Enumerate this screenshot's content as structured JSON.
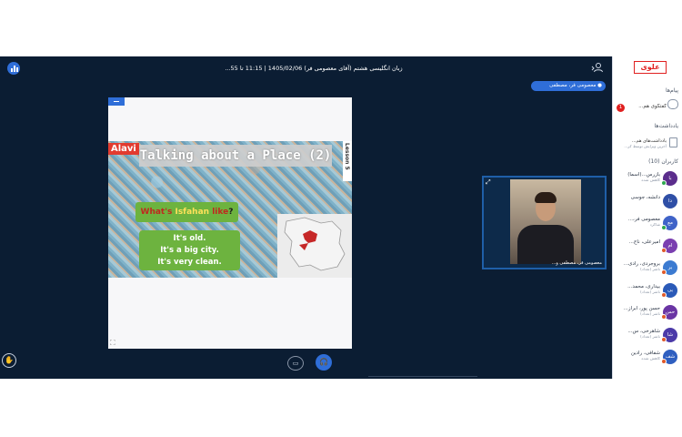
{
  "header": {
    "title": "زبان انگلیسی هشتم (آقای معصومی فر) 1405/02/06 | 11:15 تا 55...",
    "presenter_badge": "معصومی فر، مصطفی"
  },
  "slide": {
    "brand_tag": "Alavi",
    "title": "Talking about a Place (2)",
    "lesson_tag": "Lesson 5",
    "question": {
      "part1": "What's",
      "part2": " Isfahan ",
      "part3": "like",
      "part4": "?"
    },
    "answers": [
      "It's old.",
      "It's a big city.",
      "It's very clean."
    ]
  },
  "webcam": {
    "label": "معصومی فر، مصطفی و..."
  },
  "sidebar": {
    "logo": "علوی",
    "messages_heading": "پیام‌ها",
    "chat_label": "گفتگوی هم...",
    "chat_badge": "1",
    "notes_heading": "یادداشت‌ها",
    "notes_title": "یادداشت‌های هم...",
    "notes_subtitle": "آخرین ویرایش توسط کر...",
    "users_heading": "کاربران (10)",
    "users": [
      {
        "initials": "با",
        "name": "بازرس...(اسما)",
        "status": "کاهش شده",
        "color": "#5b2d8c",
        "dot": "#2fa84f"
      },
      {
        "initials": "دا",
        "name": "دانشه، جوسی",
        "status": "",
        "color": "#2f4fa6",
        "dot": ""
      },
      {
        "initials": "مع",
        "name": "معصومی فر،...",
        "status": "شاگرد",
        "color": "#3f63c8",
        "dot": "#2fa84f"
      },
      {
        "initials": "ام",
        "name": "امیرعلی، ناج...",
        "status": "",
        "color": "#7a3fb0",
        "dot": "#e05a2a"
      },
      {
        "initials": "بر",
        "name": "بروجردی، رادی...",
        "status": "ناشر (تعداد)",
        "color": "#3c7bd1",
        "dot": "#e05a2a"
      },
      {
        "initials": "بی",
        "name": "بیداری، محمد...",
        "status": "ناشر (تعداد)",
        "color": "#2b5ab8",
        "dot": "#e05a2a"
      },
      {
        "initials": "حس",
        "name": "حسن پور، ابراز...",
        "status": "ناشر (تعداد)",
        "color": "#6a35a4",
        "dot": "#e05a2a"
      },
      {
        "initials": "شا",
        "name": "شاهرخی، س...",
        "status": "ناشر (تعداد)",
        "color": "#4b3aa8",
        "dot": "#e05a2a"
      },
      {
        "initials": "شف",
        "name": "شفافی، رادین",
        "status": "کاهش شده",
        "color": "#2f5fc0",
        "dot": "#e05a2a"
      }
    ]
  },
  "icons": {
    "stats": "stats-icon",
    "user_toggle": "user-toggle-icon",
    "raise_hand": "hand-icon",
    "screen_share": "screen-share-icon",
    "audio": "headphones-icon"
  },
  "colors": {
    "app_background": "#0b1d33",
    "accent": "#2f6ed8",
    "slide_green": "#6db33f",
    "brand_red": "#e23b2f"
  }
}
